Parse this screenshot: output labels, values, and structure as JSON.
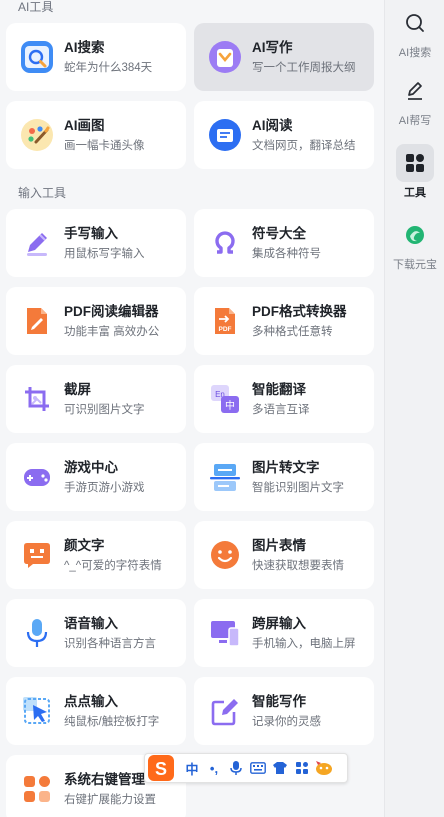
{
  "sections": {
    "ai_tools": "AI工具",
    "input_tools": "输入工具"
  },
  "cards": {
    "ai_search": {
      "title": "AI搜索",
      "subtitle": "蛇年为什么384天"
    },
    "ai_write": {
      "title": "AI写作",
      "subtitle": "写一个工作周报大纲"
    },
    "ai_draw": {
      "title": "AI画图",
      "subtitle": "画一幅卡通头像"
    },
    "ai_read": {
      "title": "AI阅读",
      "subtitle": "文档网页，翻译总结"
    },
    "handwrite": {
      "title": "手写输入",
      "subtitle": "用鼠标写字输入"
    },
    "symbols": {
      "title": "符号大全",
      "subtitle": "集成各种符号"
    },
    "pdf_editor": {
      "title": "PDF阅读编辑器",
      "subtitle": "功能丰富 高效办公"
    },
    "pdf_convert": {
      "title": "PDF格式转换器",
      "subtitle": "多种格式任意转"
    },
    "screenshot": {
      "title": "截屏",
      "subtitle": "可识别图片文字"
    },
    "translate": {
      "title": "智能翻译",
      "subtitle": "多语言互译"
    },
    "games": {
      "title": "游戏中心",
      "subtitle": "手游页游小游戏"
    },
    "img2text": {
      "title": "图片转文字",
      "subtitle": "智能识别图片文字"
    },
    "kaomoji": {
      "title": "颜文字",
      "subtitle": "^_^可爱的字符表情"
    },
    "stickers": {
      "title": "图片表情",
      "subtitle": "快速获取想要表情"
    },
    "voice": {
      "title": "语音输入",
      "subtitle": "识别各种语言方言"
    },
    "crossscreen": {
      "title": "跨屏输入",
      "subtitle": "手机输入，电脑上屏"
    },
    "clickinput": {
      "title": "点点输入",
      "subtitle": "纯鼠标/触控板打字"
    },
    "smartwrite": {
      "title": "智能写作",
      "subtitle": "记录你的灵感"
    },
    "context_menu": {
      "title": "系统右键管理",
      "subtitle": "右键扩展能力设置"
    }
  },
  "sidebar": {
    "ai_search": "AI搜索",
    "ai_help": "AI帮写",
    "tools": "工具",
    "download": "下载元宝"
  },
  "ime_bar": {
    "mode": "中",
    "punct": "•,"
  },
  "colors": {
    "accent_blue": "#2c6ef2",
    "orange": "#f47a3a",
    "purple": "#8b6cf0"
  }
}
